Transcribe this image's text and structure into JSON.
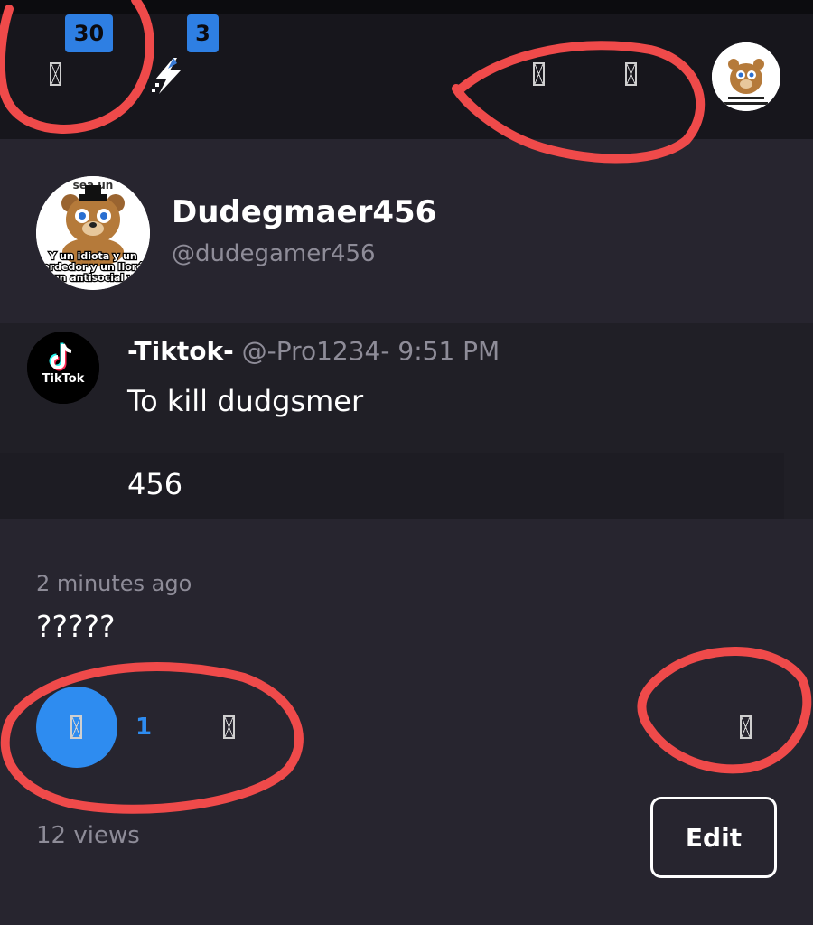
{
  "header": {
    "notification_badge": "30",
    "message_badge": "3"
  },
  "profile": {
    "display_name": "Dudegmaer456",
    "handle": "@dudegamer456"
  },
  "avatar_caption": {
    "line1": "Y un idiota y un",
    "line2": "perdedor y un llorón",
    "line3": "un antisocial y",
    "top_text": "sea un"
  },
  "quoted_post": {
    "author_name": "-Tiktok-",
    "author_handle": "@-Pro1234-",
    "time": "9:51 PM",
    "text": "To kill dudgsmer",
    "sub_text": "456",
    "logo_text": "TikTok"
  },
  "post": {
    "timestamp": "2 minutes ago",
    "text": "?????",
    "like_count": "1",
    "views": "12 views",
    "edit_label": "Edit"
  },
  "colors": {
    "accent": "#2e8cf0",
    "annotation": "#ef4a4a",
    "background": "#27252f",
    "header": "#17161c"
  },
  "icons": [
    "missing-glyph-icon",
    "lightning-logo-icon",
    "like-icon",
    "share-icon",
    "more-icon"
  ]
}
